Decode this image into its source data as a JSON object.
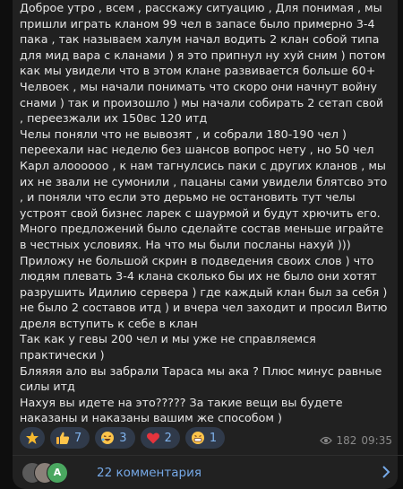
{
  "message": {
    "paragraphs": [
      "Доброе утро , всем , расскажу ситуацию ,   Для понимая , мы пришли играть кланом 99 чел в запасе было примерно 3-4 пака , так называем халум начал водить 2 клан собой типа для мид вара с кланами ) я это припнул ну хуй сним ) потом как мы увидели что в этом клане развивается больше 60+ Челвоек , мы начали понимать что скоро они начнут войну снами ) так и произошло ) мы начали собирать 2 сетап свой , переезжали их 150вс 120 итд",
      "Челы поняли что не вывозят , и собрали 180-190 чел ) переехали нас неделю без шансов вопрос нету , но 50 чел Карл алоооооо , к нам тагнулсись паки с других кланов , мы их не звали не сумонили , пацаны сами увидели блятсво это , и поняли что если это дерьмо не остановить тут челы устроят свой бизнес ларек с шаурмой и будут хрючить его.",
      "Много предложений было сделайте состав меньше играйте в честных условиях.  На что мы были посланы нахуй )))",
      "Приложу не большой скрин в подведения своих слов ) что людям плевать 3-4 клана сколько бы их не было они хотят разрушить Идилию сервера ) где каждый клан был за себя ) не было 2 составов итд ) и вчера чел заходит и просил Витю дреля вступить к себе в клан",
      "Так как у гевы 200 чел и мы уже не справляемся практически )",
      "Бляяяя ало вы забрали Тараса мы ака ? Плюс минус равные силы итд",
      "Нахуя вы идете на это????? За такие вещи вы будете наказаны и наказаны вашим же способом )"
    ]
  },
  "reactions": [
    {
      "emoji": "star",
      "count": ""
    },
    {
      "emoji": "thumbs-up",
      "count": "7"
    },
    {
      "emoji": "rofl",
      "count": "3"
    },
    {
      "emoji": "red-heart",
      "count": "2"
    },
    {
      "emoji": "grin",
      "count": "1"
    }
  ],
  "meta": {
    "views": "182",
    "time": "09:35"
  },
  "comments": {
    "label": "22 комментария",
    "avatar_letter": "A"
  },
  "colors": {
    "bubble": "#212121",
    "accent": "#76a9e7",
    "chip": "#303a4a",
    "background": "#0e0e0e"
  }
}
